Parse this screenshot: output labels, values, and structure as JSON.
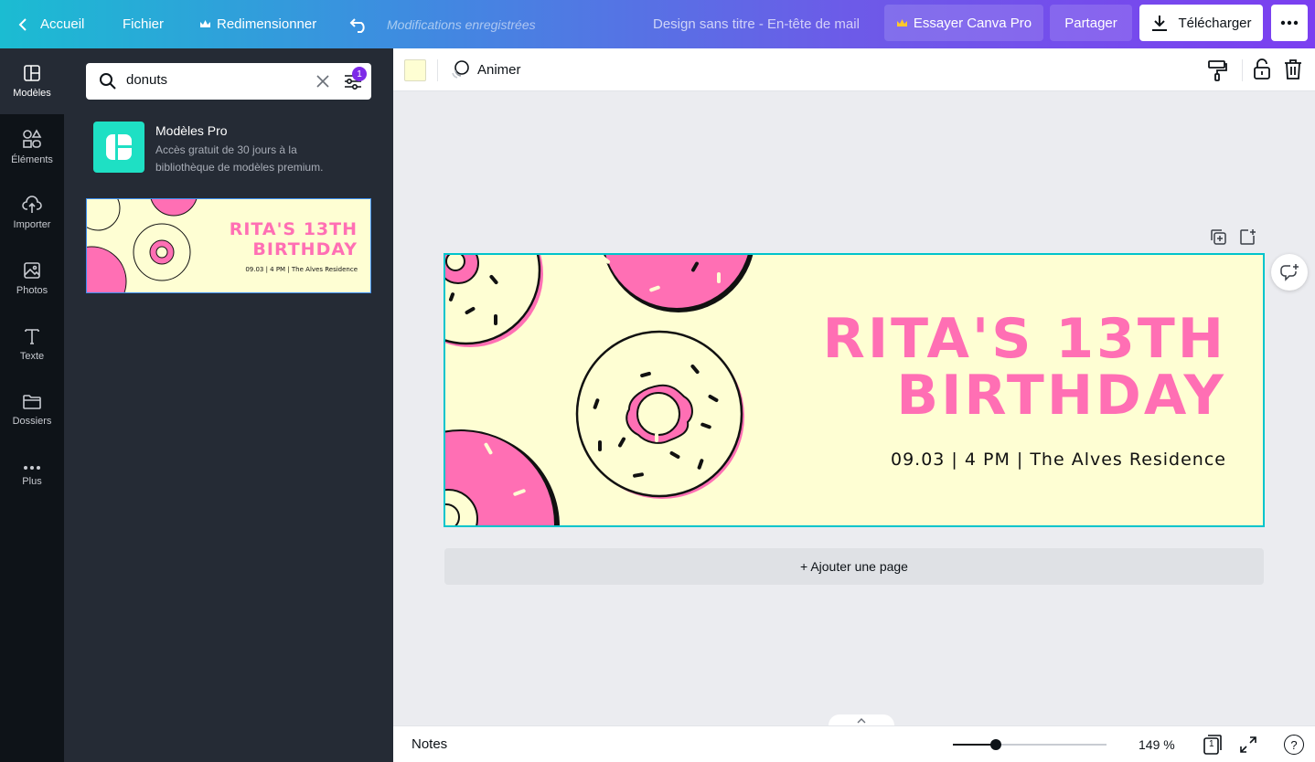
{
  "topbar": {
    "home": "Accueil",
    "file": "Fichier",
    "resize": "Redimensionner",
    "saved": "Modifications enregistrées",
    "doc_title": "Design sans titre - En-tête de mail",
    "try_pro": "Essayer Canva Pro",
    "share": "Partager",
    "download": "Télécharger"
  },
  "rail": {
    "items": [
      {
        "label": "Modèles",
        "icon": "templates-icon"
      },
      {
        "label": "Éléments",
        "icon": "elements-icon"
      },
      {
        "label": "Importer",
        "icon": "upload-icon"
      },
      {
        "label": "Photos",
        "icon": "photos-icon"
      },
      {
        "label": "Texte",
        "icon": "text-icon"
      },
      {
        "label": "Dossiers",
        "icon": "folder-icon"
      },
      {
        "label": "Plus",
        "icon": "more-dots-icon"
      }
    ]
  },
  "panel": {
    "search_value": "donuts",
    "filter_count": "1",
    "pro_title": "Modèles Pro",
    "pro_desc": "Accès gratuit de 30 jours à la bibliothèque de modèles premium.",
    "thumb_title_line1": "RITA'S 13TH",
    "thumb_title_line2": "BIRTHDAY",
    "thumb_details": "09.03 | 4 PM | The Alves Residence"
  },
  "toolbar": {
    "animate": "Animer",
    "bg_color": "#fefed3"
  },
  "design": {
    "title_line1": "RITA'S 13TH",
    "title_line2": "BIRTHDAY",
    "details": "09.03 | 4 PM | The Alves Residence",
    "colors": {
      "background": "#fefed3",
      "pink": "#ff6fb4",
      "accent": "#00c4cc"
    }
  },
  "canvas": {
    "add_page": "+ Ajouter une page"
  },
  "bottombar": {
    "notes": "Notes",
    "zoom": "149 %",
    "zoom_level": 0.28,
    "page_count": "1",
    "help": "?"
  }
}
